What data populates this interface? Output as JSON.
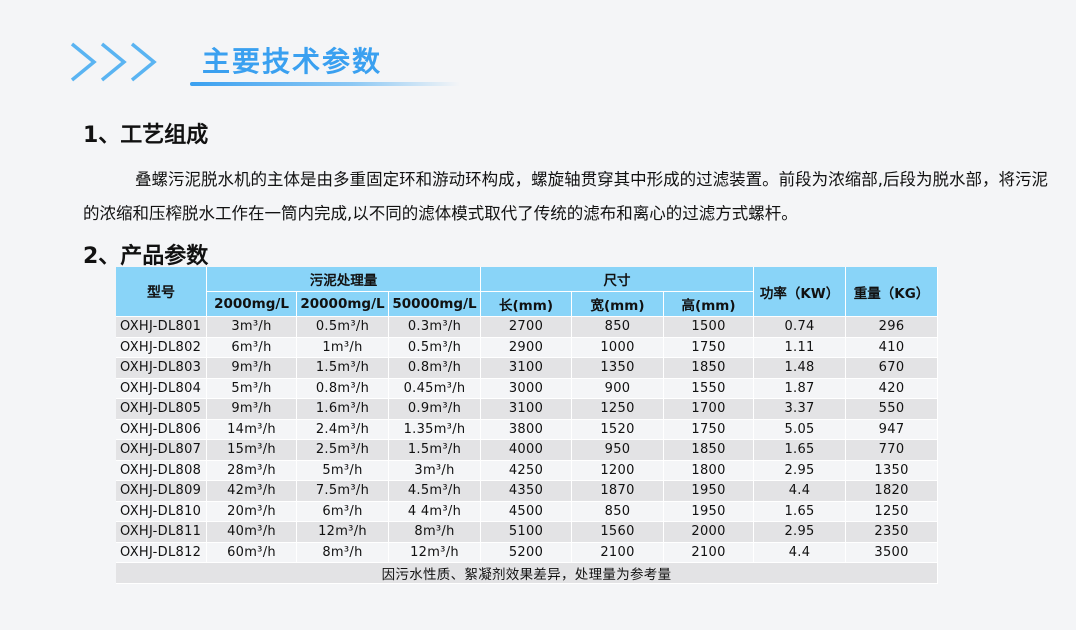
{
  "header": {
    "title": "主要技术参数"
  },
  "section1": {
    "heading": "1、工艺组成",
    "paragraph": "叠螺污泥脱水机的主体是由多重固定环和游动环构成，螺旋轴贯穿其中形成的过滤装置。前段为浓缩部,后段为脱水部，将污泥的浓缩和压榨脱水工作在一筒内完成,以不同的滤体模式取代了传统的滤布和离心的过滤方式螺杆。"
  },
  "section2": {
    "heading": "2、产品参数"
  },
  "table": {
    "h_model": "型号",
    "h_sludge": "污泥处理量",
    "h_size": "尺寸",
    "h_power": "功率（KW）",
    "h_weight": "重量（KG）",
    "h_c1": "2000mg/L",
    "h_c2": "20000mg/L",
    "h_c3": "50000mg/L",
    "h_len": "长(mm)",
    "h_wid": "宽(mm)",
    "h_hei": "高(mm)",
    "rows": [
      [
        "OXHJ-DL801",
        "3m³/h",
        "0.5m³/h",
        "0.3m³/h",
        "2700",
        "850",
        "1500",
        "0.74",
        "296"
      ],
      [
        "OXHJ-DL802",
        "6m³/h",
        "1m³/h",
        "0.5m³/h",
        "2900",
        "1000",
        "1750",
        "1.11",
        "410"
      ],
      [
        "OXHJ-DL803",
        "9m³/h",
        "1.5m³/h",
        "0.8m³/h",
        "3100",
        "1350",
        "1850",
        "1.48",
        "670"
      ],
      [
        "OXHJ-DL804",
        "5m³/h",
        "0.8m³/h",
        "0.45m³/h",
        "3000",
        "900",
        "1550",
        "1.87",
        "420"
      ],
      [
        "OXHJ-DL805",
        "9m³/h",
        "1.6m³/h",
        "0.9m³/h",
        "3100",
        "1250",
        "1700",
        "3.37",
        "550"
      ],
      [
        "OXHJ-DL806",
        "14m³/h",
        "2.4m³/h",
        "1.35m³/h",
        "3800",
        "1520",
        "1750",
        "5.05",
        "947"
      ],
      [
        "OXHJ-DL807",
        "15m³/h",
        "2.5m³/h",
        "1.5m³/h",
        "4000",
        "950",
        "1850",
        "1.65",
        "770"
      ],
      [
        "OXHJ-DL808",
        "28m³/h",
        "5m³/h",
        "3m³/h",
        "4250",
        "1200",
        "1800",
        "2.95",
        "1350"
      ],
      [
        "OXHJ-DL809",
        "42m³/h",
        "7.5m³/h",
        "4.5m³/h",
        "4350",
        "1870",
        "1950",
        "4.4",
        "1820"
      ],
      [
        "OXHJ-DL810",
        "20m³/h",
        "6m³/h",
        "4 4m³/h",
        "4500",
        "850",
        "1950",
        "1.65",
        "1250"
      ],
      [
        "OXHJ-DL811",
        "40m³/h",
        "12m³/h",
        "8m³/h",
        "5100",
        "1560",
        "2000",
        "2.95",
        "2350"
      ],
      [
        "OXHJ-DL812",
        "60m³/h",
        "8m³/h",
        "12m³/h",
        "5200",
        "2100",
        "2100",
        "4.4",
        "3500"
      ]
    ],
    "note": "因污水性质、絮凝剂效果差异，处理量为参考量"
  },
  "colors": {
    "accent": "#3aa0f0",
    "header_bg": "#89d4f8",
    "row_alt": "#e3e3e5"
  }
}
